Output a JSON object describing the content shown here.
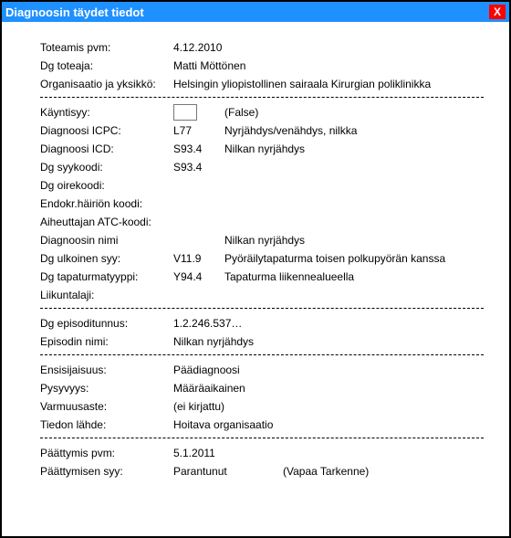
{
  "window": {
    "title": "Diagnoosin täydet tiedot",
    "close": "X"
  },
  "header": {
    "toteamis_pvm_label": "Toteamis pvm:",
    "toteamis_pvm": "4.12.2010",
    "dg_toteaja_label": "Dg toteaja:",
    "dg_toteaja": "Matti Möttönen",
    "org_label": "Organisaatio ja yksikkö:",
    "org": "Helsingin yliopistollinen sairaala Kirurgian poliklinikka"
  },
  "section1": {
    "kayntisyy_label": "Käyntisyy:",
    "kayntisyy_false": "(False)",
    "icpc_label": "Diagnoosi ICPC:",
    "icpc_code": "L77",
    "icpc_text": "Nyrjähdys/venähdys, nilkka",
    "icd_label": "Diagnoosi ICD:",
    "icd_code": "S93.4",
    "icd_text": "Nilkan nyrjähdys",
    "syykoodi_label": "Dg syykoodi:",
    "syykoodi": "S93.4",
    "oirekoodi_label": "Dg oirekoodi:",
    "endokr_label": "Endokr.häiriön koodi:",
    "atc_label": "Aiheuttajan ATC-koodi:",
    "dgnimi_label": "Diagnoosin nimi",
    "dgnimi": "Nilkan nyrjähdys",
    "ulk_label": "Dg ulkoinen syy:",
    "ulk_code": "V11.9",
    "ulk_text": "Pyöräilytapaturma toisen polkupyörän kanssa",
    "tap_label": "Dg tapaturmatyyppi:",
    "tap_code": "Y94.4",
    "tap_text": "Tapaturma liikennealueella",
    "liik_label": "Liikuntalaji:"
  },
  "section2": {
    "episodi_label": "Dg episoditunnus:",
    "episodi": "1.2.246.537…",
    "episodinimi_label": "Episodin nimi:",
    "episodinimi": "Nilkan nyrjähdys"
  },
  "section3": {
    "ensisij_label": "Ensisijaisuus:",
    "ensisij": "Päädiagnoosi",
    "pysyvyys_label": "Pysyvyys:",
    "pysyvyys": "Määräaikainen",
    "varmuus_label": "Varmuusaste:",
    "varmuus": "(ei kirjattu)",
    "lahde_label": "Tiedon lähde:",
    "lahde": "Hoitava organisaatio"
  },
  "section4": {
    "paatt_pvm_label": "Päättymis pvm:",
    "paatt_pvm": "5.1.2011",
    "paatt_syy_label": "Päättymisen syy:",
    "paatt_syy": "Parantunut",
    "paatt_tarkenne": "(Vapaa Tarkenne)"
  }
}
